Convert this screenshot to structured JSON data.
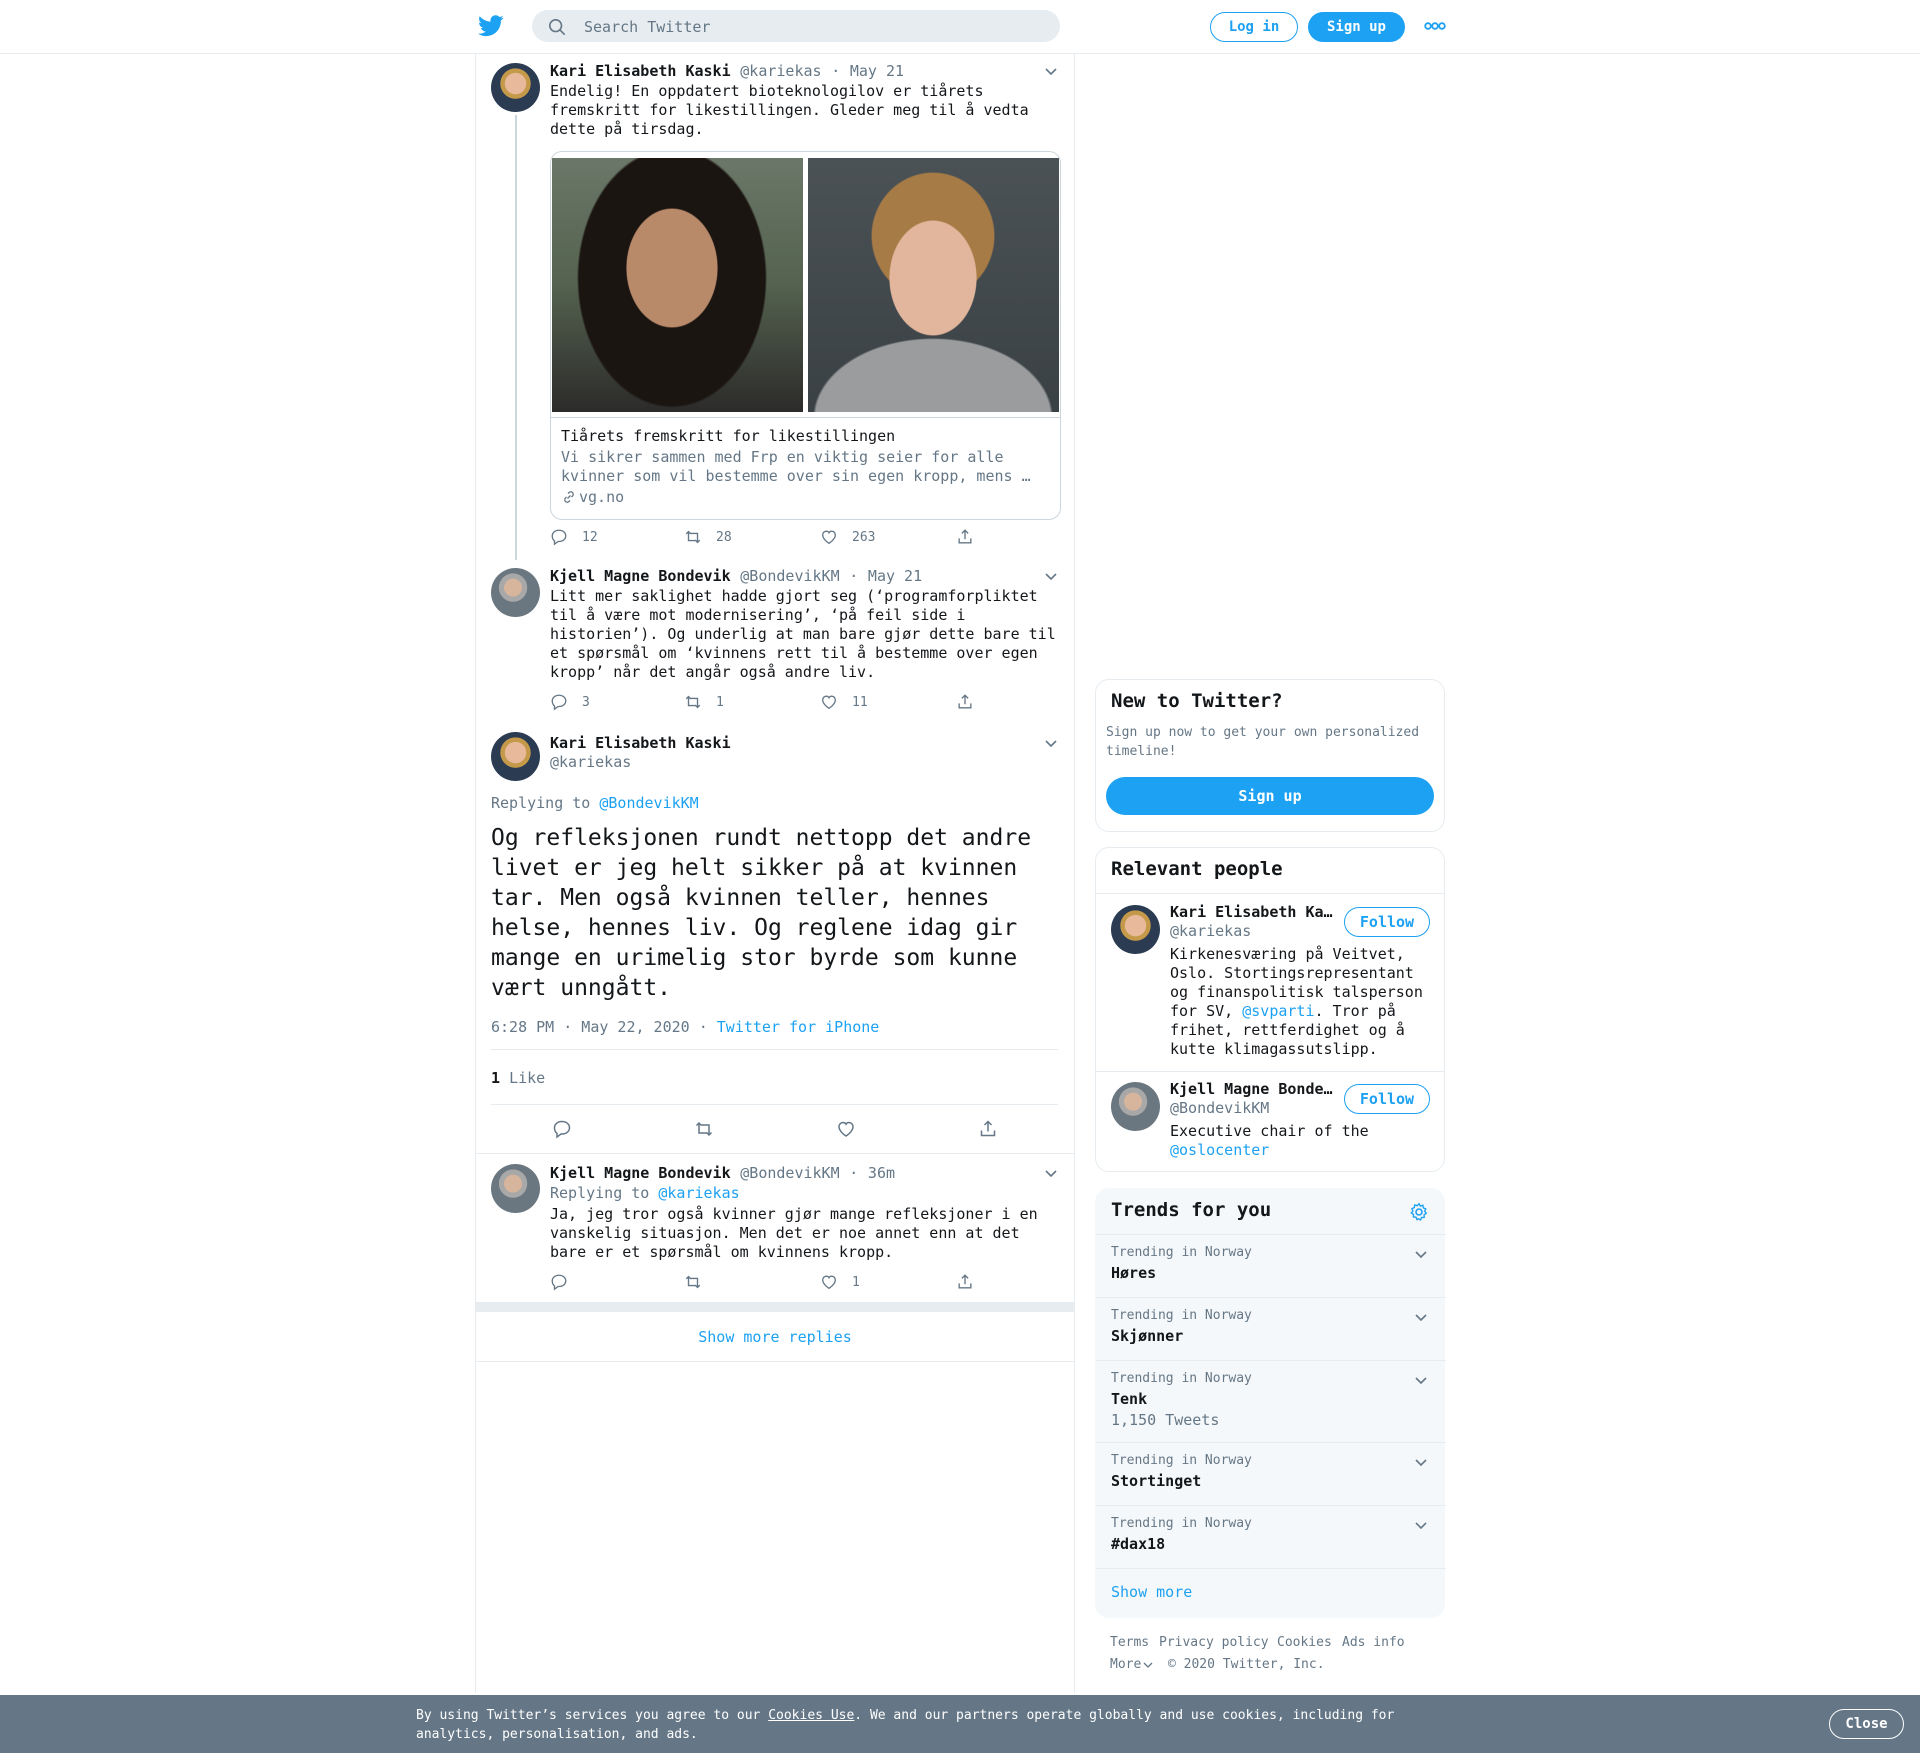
{
  "header": {
    "search_placeholder": "Search Twitter",
    "login_label": "Log in",
    "signup_label": "Sign up"
  },
  "thread": {
    "tweet1": {
      "name": "Kari Elisabeth Kaski",
      "handle": "@kariekas",
      "date": "May 21",
      "lines": [
        "Endelig! En oppdatert bioteknologilov er tiårets",
        "fremskritt for likestillingen. Gleder meg til å vedta",
        "dette på tirsdag."
      ],
      "card": {
        "title": "Tiårets fremskritt for likestillingen",
        "desc_lines": [
          "Vi sikrer sammen med Frp en viktig seier for alle",
          "kvinner som vil bestemme over sin egen kropp, mens …"
        ],
        "domain": "vg.no"
      },
      "replies": "12",
      "retweets": "28",
      "likes": "263"
    },
    "tweet2": {
      "name": "Kjell Magne Bondevik",
      "handle": "@BondevikKM",
      "date": "May 21",
      "lines": [
        "Litt mer saklighet hadde gjort seg (‘programforpliktet",
        "til å være mot modernisering’, ‘på feil side i",
        "historien’). Og underlig at man bare gjør dette bare til",
        "et spørsmål om ‘kvinnens rett til å bestemme over egen",
        "kropp’ når det angår også andre liv."
      ],
      "replies": "3",
      "retweets": "1",
      "likes": "11"
    },
    "main": {
      "name": "Kari Elisabeth Kaski",
      "handle": "@kariekas",
      "replying_prefix": "Replying to",
      "replying_to": "@BondevikKM",
      "lines": [
        "Og refleksjonen rundt nettopp det andre",
        "livet er jeg helt sikker på at kvinnen",
        "tar. Men også kvinnen teller, hennes",
        "helse, hennes liv. Og reglene idag gir",
        "mange en urimelig stor byrde som kunne",
        "vært unngått."
      ],
      "timestamp": "6:28 PM · May 22, 2020",
      "source": "Twitter for iPhone",
      "like_count": "1",
      "like_label": "Like"
    },
    "reply": {
      "name": "Kjell Magne Bondevik",
      "handle": "@BondevikKM",
      "date": "36m",
      "replying_prefix": "Replying to",
      "replying_to": "@kariekas",
      "lines": [
        "Ja, jeg tror også kvinner gjør mange refleksjoner i en",
        "vanskelig situasjon. Men det er noe annet enn at det",
        "bare er et spørsmål om kvinnens kropp."
      ],
      "likes": "1"
    },
    "show_more": "Show more replies"
  },
  "sidebar": {
    "new_to_twitter": {
      "title": "New to Twitter?",
      "lines": [
        "Sign up now to get your own personalized",
        "timeline!"
      ],
      "signup_label": "Sign up"
    },
    "relevant": {
      "title": "Relevant people",
      "people": [
        {
          "name": "Kari Elisabeth Ka…",
          "handle": "@kariekas",
          "follow": "Follow",
          "bio_lines": [
            "Kirkenesværing på Veitvet,",
            "Oslo. Stortingsrepresentant",
            "og finanspolitisk talsperson"
          ],
          "bio_pre": "for SV, ",
          "bio_link": "@svparti",
          "bio_post": ". Tror på",
          "bio_tail": [
            "frihet, rettferdighet og å",
            "kutte klimagassutslipp."
          ]
        },
        {
          "name": "Kjell Magne Bonde…",
          "handle": "@BondevikKM",
          "follow": "Follow",
          "bio_line": "Executive chair of the",
          "bio_link": "@oslocenter"
        }
      ]
    },
    "trends": {
      "title": "Trends for you",
      "items": [
        {
          "label": "Trending in Norway",
          "name": "Høres"
        },
        {
          "label": "Trending in Norway",
          "name": "Skjønner"
        },
        {
          "label": "Trending in Norway",
          "name": "Tenk",
          "count": "1,150 Tweets"
        },
        {
          "label": "Trending in Norway",
          "name": "Stortinget"
        },
        {
          "label": "Trending in Norway",
          "name": "#dax18"
        }
      ],
      "show_more": "Show more"
    },
    "footer": {
      "terms": "Terms",
      "privacy": "Privacy policy",
      "cookies": "Cookies",
      "ads": "Ads info",
      "more": "More",
      "copyright": "© 2020 Twitter, Inc."
    }
  },
  "cookie_bar": {
    "text_pre": "By using Twitter’s services you agree to our ",
    "link": "Cookies Use",
    "text_post": ". We and our partners operate globally and use cookies, including for",
    "line2": "analytics, personalisation, and ads.",
    "close": "Close"
  },
  "colors": {
    "accent": "#1da1f2",
    "secondary_text": "#657786",
    "border": "#e6ecf0"
  }
}
